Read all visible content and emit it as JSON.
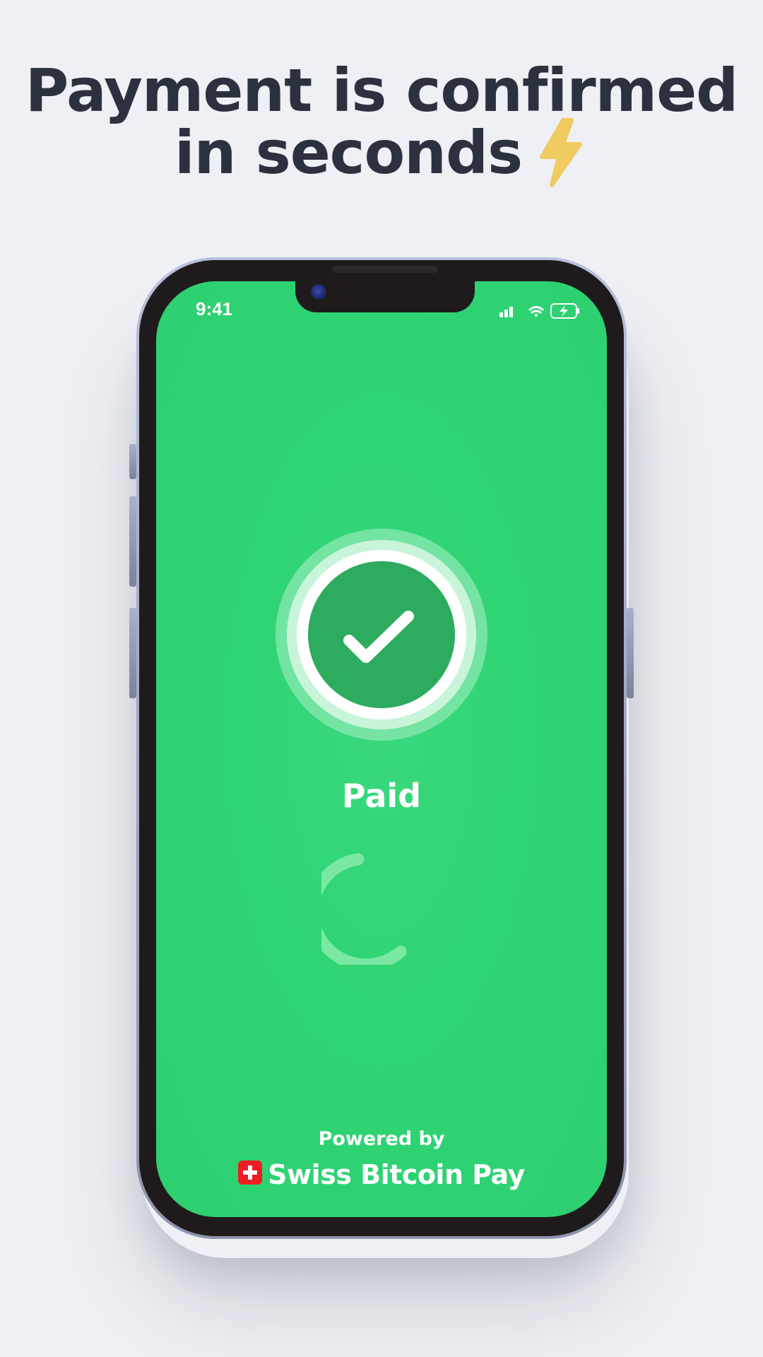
{
  "headline": {
    "line1": "Payment is confirmed",
    "line2": "in seconds"
  },
  "status_bar": {
    "time": "9:41"
  },
  "payment": {
    "status": "Paid"
  },
  "footer": {
    "powered_by": "Powered by",
    "brand_name": "Swiss Bitcoin Pay"
  },
  "colors": {
    "background": "#eff0f5",
    "headline_text": "#2c3140",
    "screen_green": "#2ed072",
    "badge_inner": "#2dab5f",
    "spinner_arc": "#7ae8a3",
    "bolt_yellow": "#efcb60",
    "swiss_red": "#ee1c24"
  },
  "icons": {
    "bolt": "lightning-bolt-icon",
    "check": "checkmark-icon",
    "spinner": "loading-spinner-icon",
    "flag": "swiss-flag-icon",
    "signal": "cellular-signal-icon",
    "wifi": "wifi-icon",
    "battery": "battery-charging-icon"
  }
}
